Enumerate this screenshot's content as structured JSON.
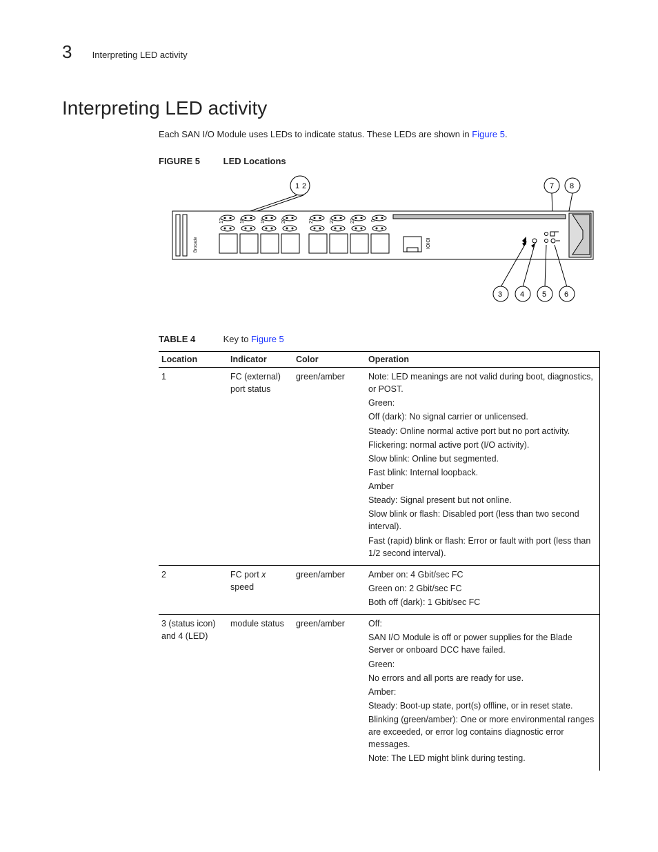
{
  "header": {
    "chapter_number": "3",
    "running_title": "Interpreting LED activity"
  },
  "title": "Interpreting LED activity",
  "intro": {
    "text_before_link": "Each SAN I/O Module uses LEDs to indicate status. These LEDs are shown in ",
    "link": "Figure 5",
    "text_after_link": "."
  },
  "figure": {
    "label": "FIGURE 5",
    "caption": "LED Locations",
    "callouts_top_pair": [
      "1",
      "2"
    ],
    "callouts_right": [
      "7",
      "8"
    ],
    "callouts_bottom": [
      "3",
      "4",
      "5",
      "6"
    ],
    "port_labels": [
      "17",
      "18",
      "19",
      "20",
      "21",
      "22",
      "23",
      "0"
    ],
    "serial_label": "IOIOI",
    "brand_label": "Brocade"
  },
  "table": {
    "label": "TABLE 4",
    "caption_before_link": "Key to ",
    "caption_link": "Figure 5",
    "headers": [
      "Location",
      "Indicator",
      "Color",
      "Operation"
    ],
    "rows": [
      {
        "location": "1",
        "indicator": "FC (external) port status",
        "color": "green/amber",
        "operation": [
          "Note: LED meanings are not valid during boot, diagnostics, or POST.",
          "Green:",
          "Off (dark): No signal carrier or unlicensed.",
          "Steady: Online normal active port but no port activity.",
          "Flickering: normal active port (I/O activity).",
          "Slow blink: Online but segmented.",
          "Fast blink: Internal loopback.",
          "Amber",
          "Steady: Signal present but not online.",
          "Slow blink or flash: Disabled port (less than two second interval).",
          "Fast (rapid) blink or flash: Error or fault with port (less than 1/2 second interval)."
        ]
      },
      {
        "location": "2",
        "indicator_before_italic": "FC port ",
        "indicator_italic": "x",
        "indicator_after_italic": " speed",
        "color": "green/amber",
        "operation": [
          "Amber on: 4 Gbit/sec FC",
          "Green on: 2 Gbit/sec FC",
          "Both off (dark): 1 Gbit/sec FC"
        ]
      },
      {
        "location": "3 (status icon) and 4 (LED)",
        "indicator": "module status",
        "color": "green/amber",
        "operation": [
          "Off:",
          "SAN I/O Module is off or power supplies for the Blade Server or onboard DCC have failed.",
          "Green:",
          "No errors and all ports are ready for use.",
          "Amber:",
          "Steady: Boot-up state, port(s) offline, or in reset state.",
          "Blinking (green/amber): One or more environmental ranges are exceeded, or error log contains diagnostic error messages.",
          "Note: The LED might blink during testing."
        ]
      }
    ]
  }
}
